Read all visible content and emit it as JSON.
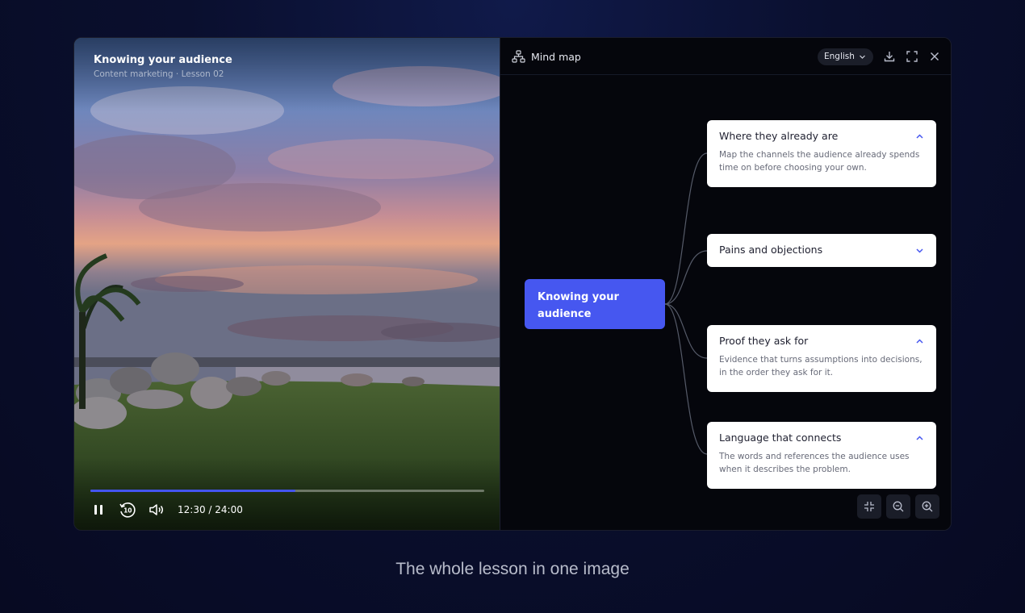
{
  "video": {
    "title": "Knowing your audience",
    "subtitle": "Content marketing · Lesson 02",
    "progress_fraction": 0.52,
    "time": "12:30 / 24:00",
    "controls": [
      "pause-icon",
      "rewind-10-icon",
      "volume-icon"
    ],
    "rewind_label": "10"
  },
  "mindmap": {
    "title": "Mind map",
    "language": "English",
    "header_icons": [
      "download-icon",
      "fullscreen-icon",
      "close-icon"
    ],
    "root": "Knowing your audience",
    "nodes": [
      {
        "title": "Where they already are",
        "desc": "Map the channels the audience already spends time on before choosing your own.",
        "expanded": true
      },
      {
        "title": "Pains and objections",
        "desc": "",
        "expanded": false
      },
      {
        "title": "Proof they ask for",
        "desc": "Evidence that turns assumptions into decisions, in the order they ask for it.",
        "expanded": true
      },
      {
        "title": "Language that connects",
        "desc": "The words and references the audience uses when it describes the problem.",
        "expanded": true
      }
    ],
    "zoom_controls": [
      "fit-icon",
      "zoom-out-icon",
      "zoom-in-icon"
    ]
  },
  "tagline": "The whole lesson in one image",
  "colors": {
    "accent": "#4657f0",
    "background": "#0a0f2e",
    "node_bg": "#ffffff"
  }
}
